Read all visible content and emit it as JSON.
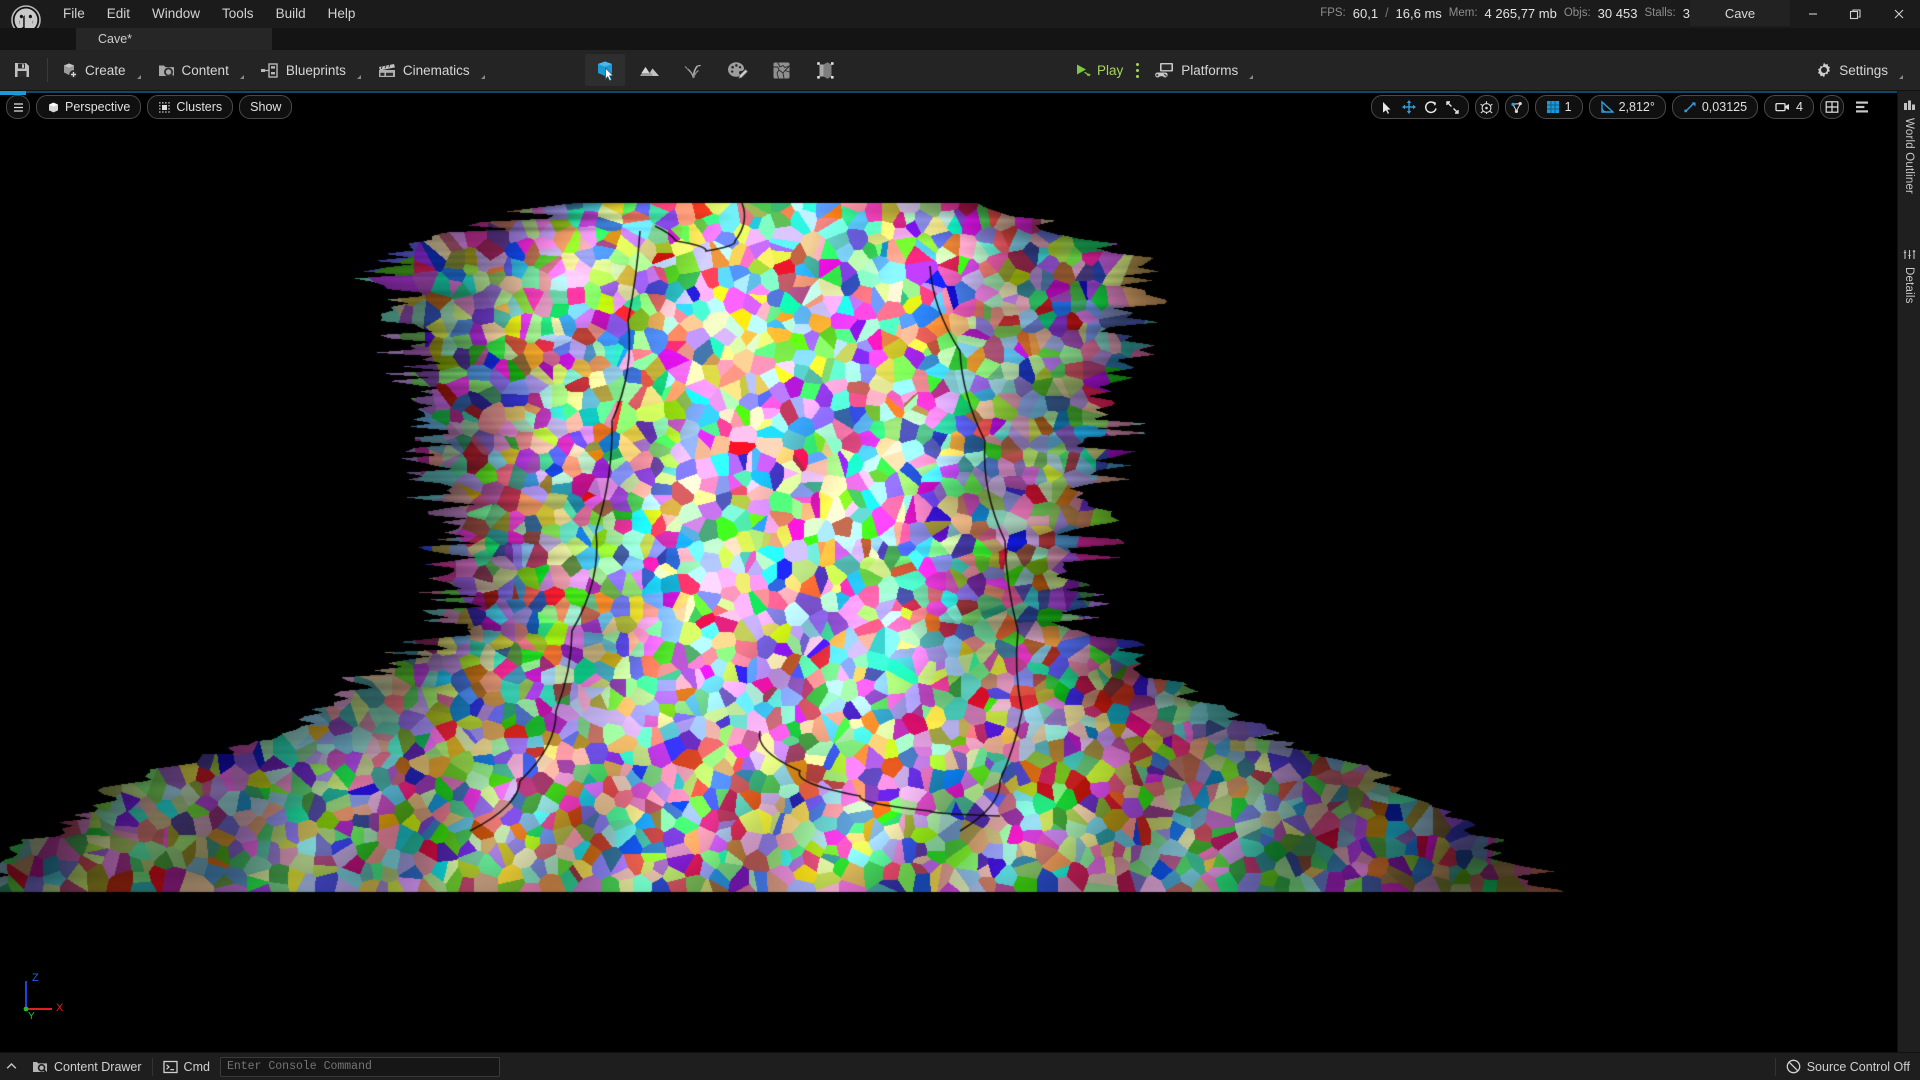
{
  "window": {
    "title": "Cave",
    "minimize_label": "Minimize",
    "maximize_label": "Maximize",
    "close_label": "Close"
  },
  "menubar": {
    "items": [
      "File",
      "Edit",
      "Window",
      "Tools",
      "Build",
      "Help"
    ]
  },
  "project_tab": {
    "label": "Cave*"
  },
  "stats": {
    "fps_label": "FPS:",
    "fps_value": "60,1",
    "separator": "/",
    "frametime": "16,6 ms",
    "mem_label": "Mem:",
    "mem_value": "4 265,77 mb",
    "objs_label": "Objs:",
    "objs_value": "30 453",
    "stalls_label": "Stalls:",
    "stalls_value": "3"
  },
  "toolbar": {
    "save_label": "Save",
    "buttons": [
      {
        "label": "Create",
        "icon": "create-cube-icon"
      },
      {
        "label": "Content",
        "icon": "content-folder-icon"
      },
      {
        "label": "Blueprints",
        "icon": "blueprints-node-icon"
      },
      {
        "label": "Cinematics",
        "icon": "cinematics-clapper-icon"
      }
    ],
    "modes": [
      {
        "name": "select-mode",
        "active": true
      },
      {
        "name": "landscape-mode",
        "active": false
      },
      {
        "name": "foliage-mode",
        "active": false
      },
      {
        "name": "mesh-paint-mode",
        "active": false
      },
      {
        "name": "fracture-mode",
        "active": false
      },
      {
        "name": "brush-edit-mode",
        "active": false
      }
    ],
    "play_label": "Play",
    "platforms_label": "Platforms",
    "settings_label": "Settings"
  },
  "viewport": {
    "left_controls": [
      {
        "label": "Perspective",
        "icon": "cube-icon"
      },
      {
        "label": "Clusters",
        "icon": "cluster-view-icon"
      },
      {
        "label": "Show",
        "icon": ""
      }
    ],
    "menu_label": "Viewport Options",
    "transform_tools": [
      "select-tool",
      "move-tool",
      "rotate-tool",
      "scale-tool"
    ],
    "coordinate_system": "world-space-icon",
    "surface_snap": "surface-snap-icon",
    "grid_snap_value": "1",
    "angle_snap_value": "2,812°",
    "scale_snap_value": "0,03125",
    "camera_speed_value": "4",
    "layout_label": "Layout",
    "axis_x": "X",
    "axis_y": "Y",
    "axis_z": "Z",
    "axis_colors": {
      "x": "#e02020",
      "y": "#20c020",
      "z": "#2040e0"
    }
  },
  "right_rail": {
    "tabs": [
      {
        "label": "World Outliner",
        "icon": "outliner-icon"
      },
      {
        "label": "Details",
        "icon": "details-icon"
      }
    ]
  },
  "statusbar": {
    "content_drawer_label": "Content Drawer",
    "cmd_label": "Cmd",
    "console_placeholder": "Enter Console Command",
    "source_control_label": "Source Control Off"
  },
  "theme": {
    "accent": "#1a9bd7",
    "play_green": "#a4d65e",
    "bg_dark": "#1a1a1a",
    "toolbar_bg": "#242424",
    "viewport_bg": "#000000"
  }
}
